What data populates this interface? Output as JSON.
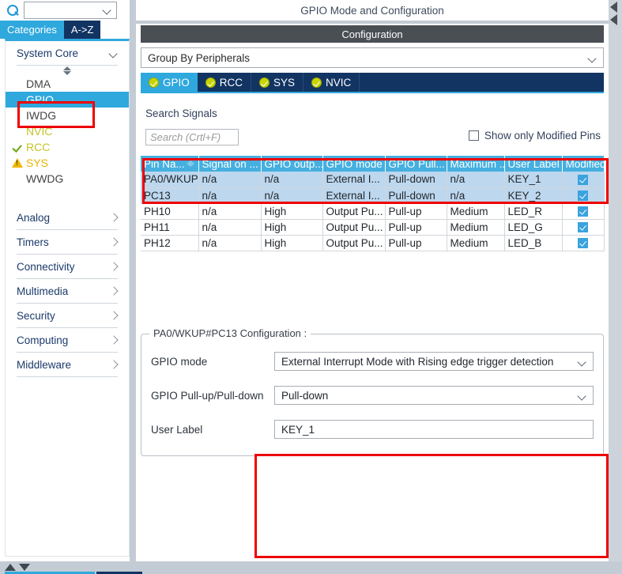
{
  "left_panel": {
    "search": {
      "value": "",
      "icon": "search-icon"
    },
    "tabs": [
      {
        "label": "Categories",
        "active": true
      },
      {
        "label": "A->Z",
        "active": false
      }
    ],
    "group": {
      "label": "System Core",
      "expanded": true
    },
    "tree_items": [
      {
        "label": "DMA",
        "state": "none",
        "selected": false
      },
      {
        "label": "GPIO",
        "state": "none",
        "selected": true
      },
      {
        "label": "IWDG",
        "state": "none",
        "selected": false
      },
      {
        "label": "NVIC",
        "state": "partial",
        "selected": false
      },
      {
        "label": "RCC",
        "state": "ok",
        "selected": false
      },
      {
        "label": "SYS",
        "state": "warning",
        "selected": false
      },
      {
        "label": "WWDG",
        "state": "none",
        "selected": false
      }
    ],
    "categories": [
      {
        "label": "Analog"
      },
      {
        "label": "Timers"
      },
      {
        "label": "Connectivity"
      },
      {
        "label": "Multimedia"
      },
      {
        "label": "Security"
      },
      {
        "label": "Computing"
      },
      {
        "label": "Middleware"
      }
    ]
  },
  "main": {
    "mode_title": "GPIO Mode and Configuration",
    "configuration_banner": "Configuration",
    "group_by": {
      "value": "Group By Peripherals"
    },
    "peripheral_tabs": [
      {
        "label": "GPIO",
        "active": true,
        "status": "ok"
      },
      {
        "label": "RCC",
        "active": false,
        "status": "ok"
      },
      {
        "label": "SYS",
        "active": false,
        "status": "ok"
      },
      {
        "label": "NVIC",
        "active": false,
        "status": "ok"
      }
    ],
    "search_signals_label": "Search Signals",
    "signal_search": {
      "placeholder": "Search (Crtl+F)",
      "value": ""
    },
    "show_modified_pins": {
      "label": "Show only Modified Pins",
      "checked": false
    },
    "table": {
      "columns": [
        "Pin Na...",
        "Signal on ...",
        "GPIO outp...",
        "GPIO mode",
        "GPIO Pull...",
        "Maximum ...",
        "User Label",
        "Modified"
      ],
      "sorted_column": "Pin Na...",
      "rows": [
        {
          "pin": "PA0/WKUP",
          "signal": "n/a",
          "output": "n/a",
          "mode": "External I...",
          "pull": "Pull-down",
          "speed": "n/a",
          "label": "KEY_1",
          "modified": true,
          "selected": true
        },
        {
          "pin": "PC13",
          "signal": "n/a",
          "output": "n/a",
          "mode": "External I...",
          "pull": "Pull-down",
          "speed": "n/a",
          "label": "KEY_2",
          "modified": true,
          "selected": true
        },
        {
          "pin": "PH10",
          "signal": "n/a",
          "output": "High",
          "mode": "Output Pu...",
          "pull": "Pull-up",
          "speed": "Medium",
          "label": "LED_R",
          "modified": true,
          "selected": false
        },
        {
          "pin": "PH11",
          "signal": "n/a",
          "output": "High",
          "mode": "Output Pu...",
          "pull": "Pull-up",
          "speed": "Medium",
          "label": "LED_G",
          "modified": true,
          "selected": false
        },
        {
          "pin": "PH12",
          "signal": "n/a",
          "output": "High",
          "mode": "Output Pu...",
          "pull": "Pull-up",
          "speed": "Medium",
          "label": "LED_B",
          "modified": true,
          "selected": false
        }
      ]
    },
    "pin_config": {
      "legend": "PA0/WKUP#PC13 Configuration :",
      "fields": [
        {
          "label": "GPIO mode",
          "value": "External Interrupt Mode with Rising edge trigger detection",
          "type": "select"
        },
        {
          "label": "GPIO Pull-up/Pull-down",
          "value": "Pull-down",
          "type": "select"
        },
        {
          "label": "User Label",
          "value": "KEY_1",
          "type": "text"
        }
      ]
    }
  },
  "colors": {
    "accent_blue": "#2fa8dd",
    "dark_navy": "#123463",
    "table_header": "#45b0e0",
    "selection_row": "#bdd7ee",
    "annotation_red": "#ee0000",
    "banner_gray": "#4a4f54"
  }
}
